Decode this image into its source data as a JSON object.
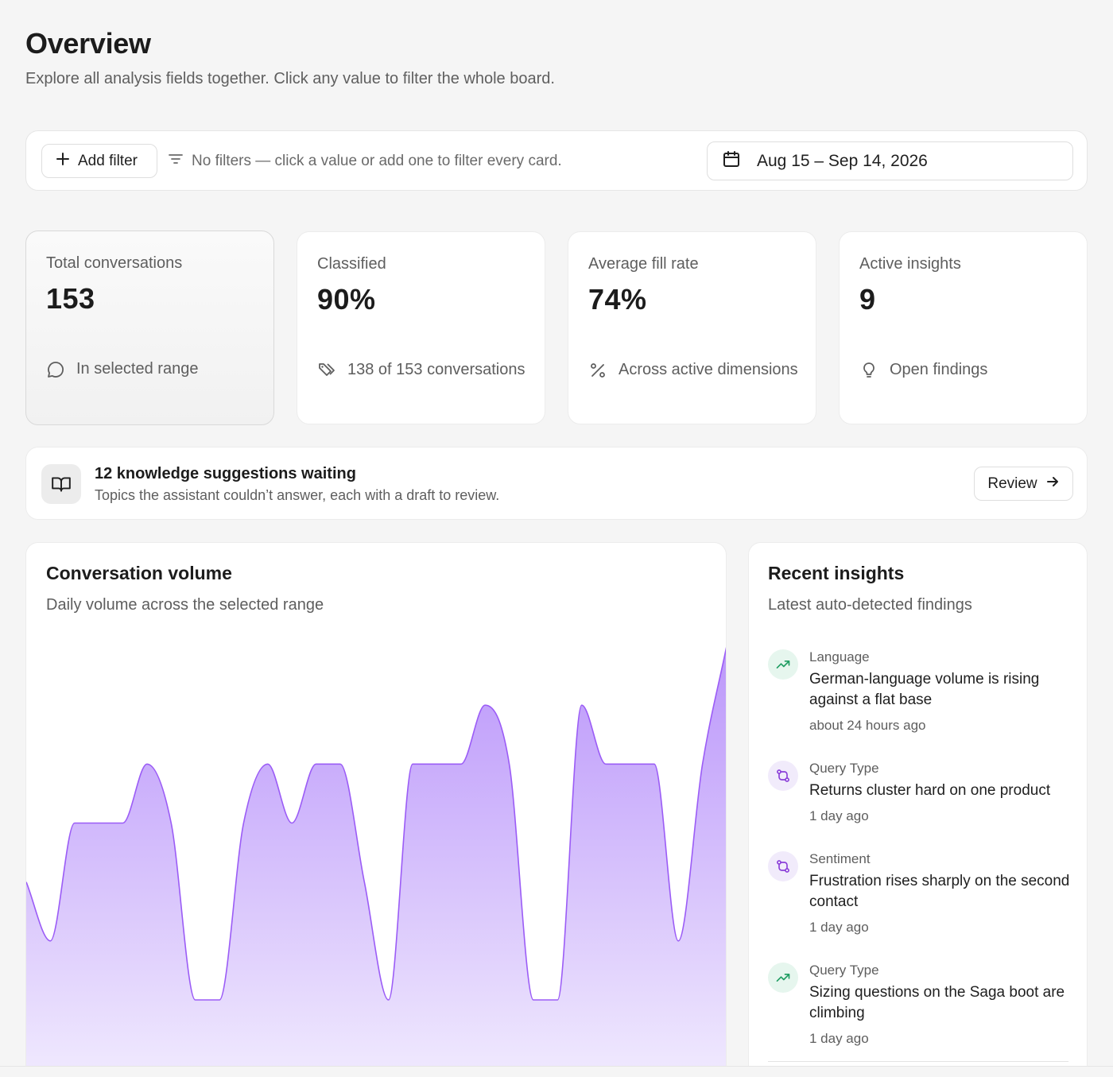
{
  "header": {
    "title": "Overview",
    "subtitle": "Explore all analysis fields together. Click any value to filter the whole board."
  },
  "filters": {
    "add_label": "Add filter",
    "hint": "No filters — click a value or add one to filter every card.",
    "date_range": "Aug 15 – Sep 14, 2026"
  },
  "stats": [
    {
      "label": "Total conversations",
      "value": "153",
      "foot": "In selected range",
      "icon": "message-circle-icon"
    },
    {
      "label": "Classified",
      "value": "90%",
      "foot": "138 of 153 conversations",
      "icon": "tags-icon"
    },
    {
      "label": "Average fill rate",
      "value": "74%",
      "foot": "Across active dimensions",
      "icon": "percent-icon"
    },
    {
      "label": "Active insights",
      "value": "9",
      "foot": "Open findings",
      "icon": "lightbulb-icon"
    }
  ],
  "banner": {
    "title": "12 knowledge suggestions waiting",
    "subtitle": "Topics the assistant couldn’t answer, each with a draft to review.",
    "button": "Review",
    "icon": "book-open-icon"
  },
  "volume_card": {
    "title": "Conversation volume",
    "subtitle": "Daily volume across the selected range"
  },
  "chart_data": {
    "type": "area",
    "title": "Conversation volume",
    "subtitle": "Daily volume across the selected range",
    "x": [
      1,
      2,
      3,
      4,
      5,
      6,
      7,
      8,
      9,
      10,
      11,
      12,
      13,
      14,
      15,
      16,
      17,
      18,
      19,
      20,
      21,
      22,
      23,
      24,
      25,
      26,
      27,
      28,
      29,
      30
    ],
    "values": [
      4,
      3,
      5,
      5,
      5,
      6,
      5,
      2,
      2,
      5,
      6,
      5,
      6,
      6,
      4,
      2,
      6,
      6,
      6,
      7,
      6,
      2,
      2,
      7,
      6,
      6,
      6,
      3,
      6,
      8
    ],
    "ylim": [
      2,
      8
    ],
    "grid": false,
    "line_color": "#9b5cf6",
    "fill_color": "#c4a6fb"
  },
  "insights": {
    "title": "Recent insights",
    "subtitle": "Latest auto-detected findings",
    "items": [
      {
        "category": "Language",
        "text": "German-language volume is rising against a flat base",
        "time": "about 24 hours ago",
        "icon": "trending-up-icon",
        "kind": "up"
      },
      {
        "category": "Query Type",
        "text": "Returns cluster hard on one product",
        "time": "1 day ago",
        "icon": "git-compare-icon",
        "kind": "flow"
      },
      {
        "category": "Sentiment",
        "text": "Frustration rises sharply on the second contact",
        "time": "1 day ago",
        "icon": "git-compare-icon",
        "kind": "flow"
      },
      {
        "category": "Query Type",
        "text": "Sizing questions on the Saga boot are climbing",
        "time": "1 day ago",
        "icon": "trending-up-icon",
        "kind": "up"
      }
    ]
  },
  "colors": {
    "accent": "#9b5cf6",
    "trend_up": "#1f9d62",
    "flow": "#8b3fd9"
  }
}
